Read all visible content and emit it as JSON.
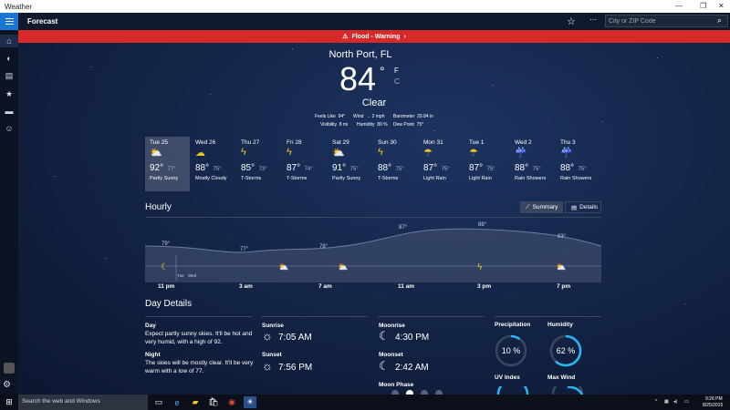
{
  "window": {
    "title": "Weather",
    "controls": [
      "—",
      "❐",
      "✕"
    ]
  },
  "appbar": {
    "title": "Forecast",
    "search_placeholder": "City or ZIP Code",
    "more": "···"
  },
  "alert": {
    "text": "Flood - Warning"
  },
  "current": {
    "location": "North Port, FL",
    "temp": "84",
    "degree": "°",
    "unit_f": "F",
    "unit_c": "C",
    "condition": "Clear",
    "stats": [
      {
        "label": "Feels Like",
        "value": "94°"
      },
      {
        "label": "Wind",
        "value": "→ 2 mph"
      },
      {
        "label": "Barometer",
        "value": "29.84 in"
      },
      {
        "label": "Visibility",
        "value": "8 mi"
      },
      {
        "label": "Humidity",
        "value": "80 %"
      },
      {
        "label": "Dew Point",
        "value": "75°"
      }
    ]
  },
  "forecast": [
    {
      "day": "Tue 25",
      "icon": "partly-sunny",
      "hi": "92°",
      "lo": "77°",
      "desc": "Partly Sunny",
      "selected": true
    },
    {
      "day": "Wed 26",
      "icon": "mostly-cloudy",
      "hi": "88°",
      "lo": "75°",
      "desc": "Mostly Cloudy"
    },
    {
      "day": "Thu 27",
      "icon": "t-storms",
      "hi": "85°",
      "lo": "73°",
      "desc": "T-Storms"
    },
    {
      "day": "Fri 28",
      "icon": "t-storms",
      "hi": "87°",
      "lo": "74°",
      "desc": "T-Storms"
    },
    {
      "day": "Sat 29",
      "icon": "partly-sunny",
      "hi": "91°",
      "lo": "75°",
      "desc": "Partly Sunny"
    },
    {
      "day": "Sun 30",
      "icon": "t-storms",
      "hi": "88°",
      "lo": "75°",
      "desc": "T-Storms"
    },
    {
      "day": "Mon 31",
      "icon": "light-rain",
      "hi": "87°",
      "lo": "75°",
      "desc": "Light Rain"
    },
    {
      "day": "Tue 1",
      "icon": "light-rain",
      "hi": "87°",
      "lo": "75°",
      "desc": "Light Rain"
    },
    {
      "day": "Wed 2",
      "icon": "rain-showers",
      "hi": "88°",
      "lo": "75°",
      "desc": "Rain Showers"
    },
    {
      "day": "Thu 3",
      "icon": "rain-showers",
      "hi": "88°",
      "lo": "75°",
      "desc": "Rain Showers"
    }
  ],
  "hourly": {
    "title": "Hourly",
    "summary_label": "Summary",
    "details_label": "Details",
    "temps": [
      "79°",
      "77°",
      "78°",
      "87°",
      "88°",
      "83°"
    ],
    "markers": [
      "Tue",
      "Wed"
    ],
    "times": [
      "11 pm",
      "3 am",
      "7 am",
      "11 am",
      "3 pm",
      "7 pm"
    ],
    "icons": [
      "moon",
      "partly-cloudy",
      "partly-cloudy",
      "t-storms",
      "partly-cloudy"
    ]
  },
  "details": {
    "title": "Day Details",
    "day_label": "Day",
    "day_text": "Expect partly sunny skies. It'll be hot and very humid, with a high of 92.",
    "night_label": "Night",
    "night_text": "The skies will be mostly clear. It'll be very warm with a low of 77.",
    "sunrise_label": "Sunrise",
    "sunrise": "7:05 AM",
    "sunset_label": "Sunset",
    "sunset": "7:56 PM",
    "moonrise_label": "Moonrise",
    "moonrise": "4:30 PM",
    "moonset_label": "Moonset",
    "moonset": "2:42 AM",
    "moonphase_label": "Moon Phase",
    "precip_label": "Precipitation",
    "precip": "10 %",
    "precip_fraction": 0.1,
    "humidity_label": "Humidity",
    "humidity": "62 %",
    "humidity_fraction": 0.62,
    "uv_label": "UV Index",
    "wind_label": "Max Wind"
  },
  "taskbar": {
    "search_text": "Search the web and Windows",
    "time": "9:26 PM",
    "date": "8/25/2015"
  },
  "colors": {
    "accent": "#1976d2",
    "alert": "#d62a2a",
    "ring": "#29b6f6",
    "sun": "#f0c419"
  }
}
